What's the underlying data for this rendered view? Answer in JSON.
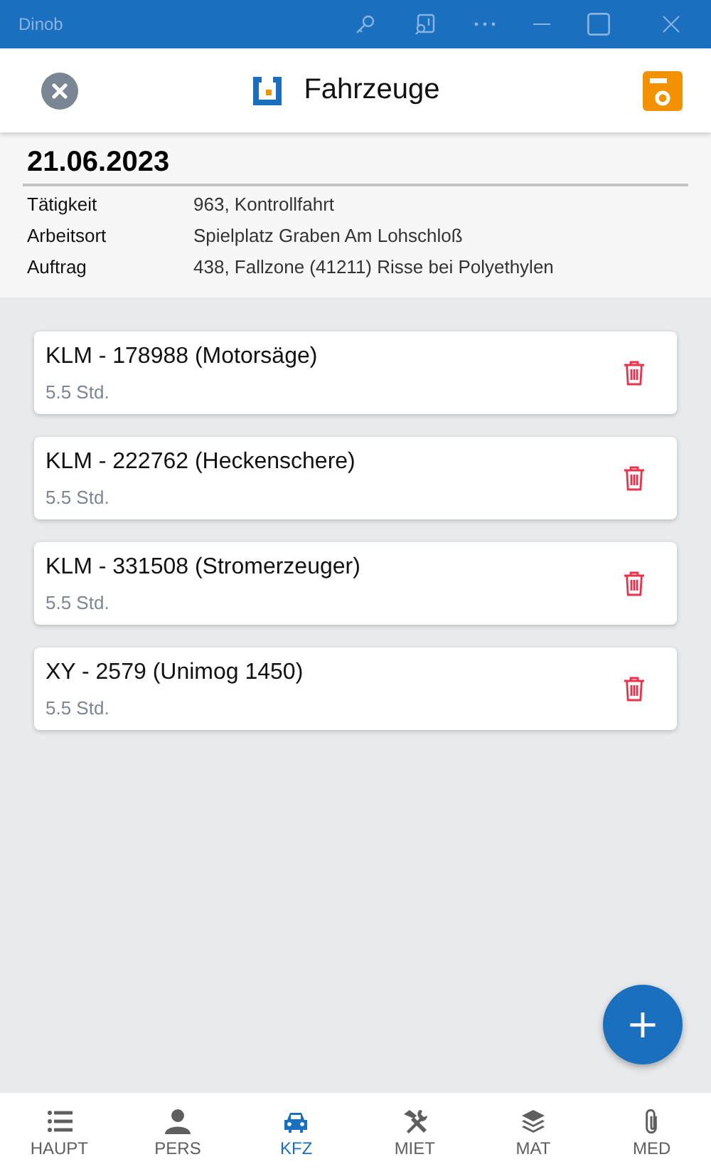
{
  "window": {
    "title": "Dinob"
  },
  "header": {
    "title": "Fahrzeuge"
  },
  "info": {
    "date": "21.06.2023",
    "rows": [
      {
        "label": "Tätigkeit",
        "value": "963, Kontrollfahrt"
      },
      {
        "label": "Arbeitsort",
        "value": "Spielplatz Graben Am Lohschloß"
      },
      {
        "label": "Auftrag",
        "value": "438, Fallzone (41211) Risse bei Polyethylen"
      }
    ]
  },
  "vehicles": [
    {
      "name": "KLM - 178988 (Motorsäge)",
      "hours": "5.5 Std."
    },
    {
      "name": "KLM - 222762 (Heckenschere)",
      "hours": "5.5 Std."
    },
    {
      "name": "KLM - 331508 (Stromerzeuger)",
      "hours": "5.5 Std."
    },
    {
      "name": "XY - 2579 (Unimog 1450)",
      "hours": "5.5 Std."
    }
  ],
  "fab": {
    "label": "+"
  },
  "nav": [
    {
      "label": "HAUPT",
      "selected": false
    },
    {
      "label": "PERS",
      "selected": false
    },
    {
      "label": "KFZ",
      "selected": true
    },
    {
      "label": "MIET",
      "selected": false
    },
    {
      "label": "MAT",
      "selected": false
    },
    {
      "label": "MED",
      "selected": false
    }
  ]
}
